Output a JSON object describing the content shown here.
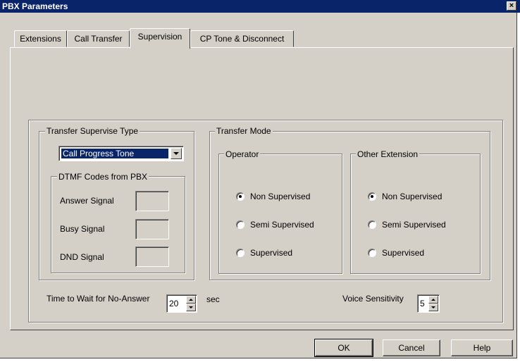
{
  "window": {
    "title": "PBX Parameters",
    "close_glyph": "×"
  },
  "tabs": [
    {
      "label": "Extensions"
    },
    {
      "label": "Call Transfer"
    },
    {
      "label": "Supervision"
    },
    {
      "label": "CP Tone & Disconnect"
    }
  ],
  "active_tab": "Supervision",
  "transfer_supervise_type": {
    "legend": "Transfer Supervise Type",
    "selected": "Call Progress Tone",
    "dtmf": {
      "legend": "DTMF Codes from PBX",
      "rows": [
        {
          "label": "Answer Signal",
          "value": ""
        },
        {
          "label": "Busy Signal",
          "value": ""
        },
        {
          "label": "DND Signal",
          "value": ""
        }
      ]
    }
  },
  "transfer_mode": {
    "legend": "Transfer Mode",
    "operator": {
      "legend": "Operator",
      "options": [
        "Non Supervised",
        "Semi Supervised",
        "Supervised"
      ],
      "selected": "Non Supervised"
    },
    "other_extension": {
      "legend": "Other Extension",
      "options": [
        "Non Supervised",
        "Semi Supervised",
        "Supervised"
      ],
      "selected": "Non Supervised"
    }
  },
  "no_answer": {
    "label": "Time to Wait for No-Answer",
    "value": "20",
    "unit": "sec"
  },
  "voice_sensitivity": {
    "label": "Voice Sensitivity",
    "value": "5"
  },
  "buttons": {
    "ok": "OK",
    "cancel": "Cancel",
    "help": "Help"
  }
}
